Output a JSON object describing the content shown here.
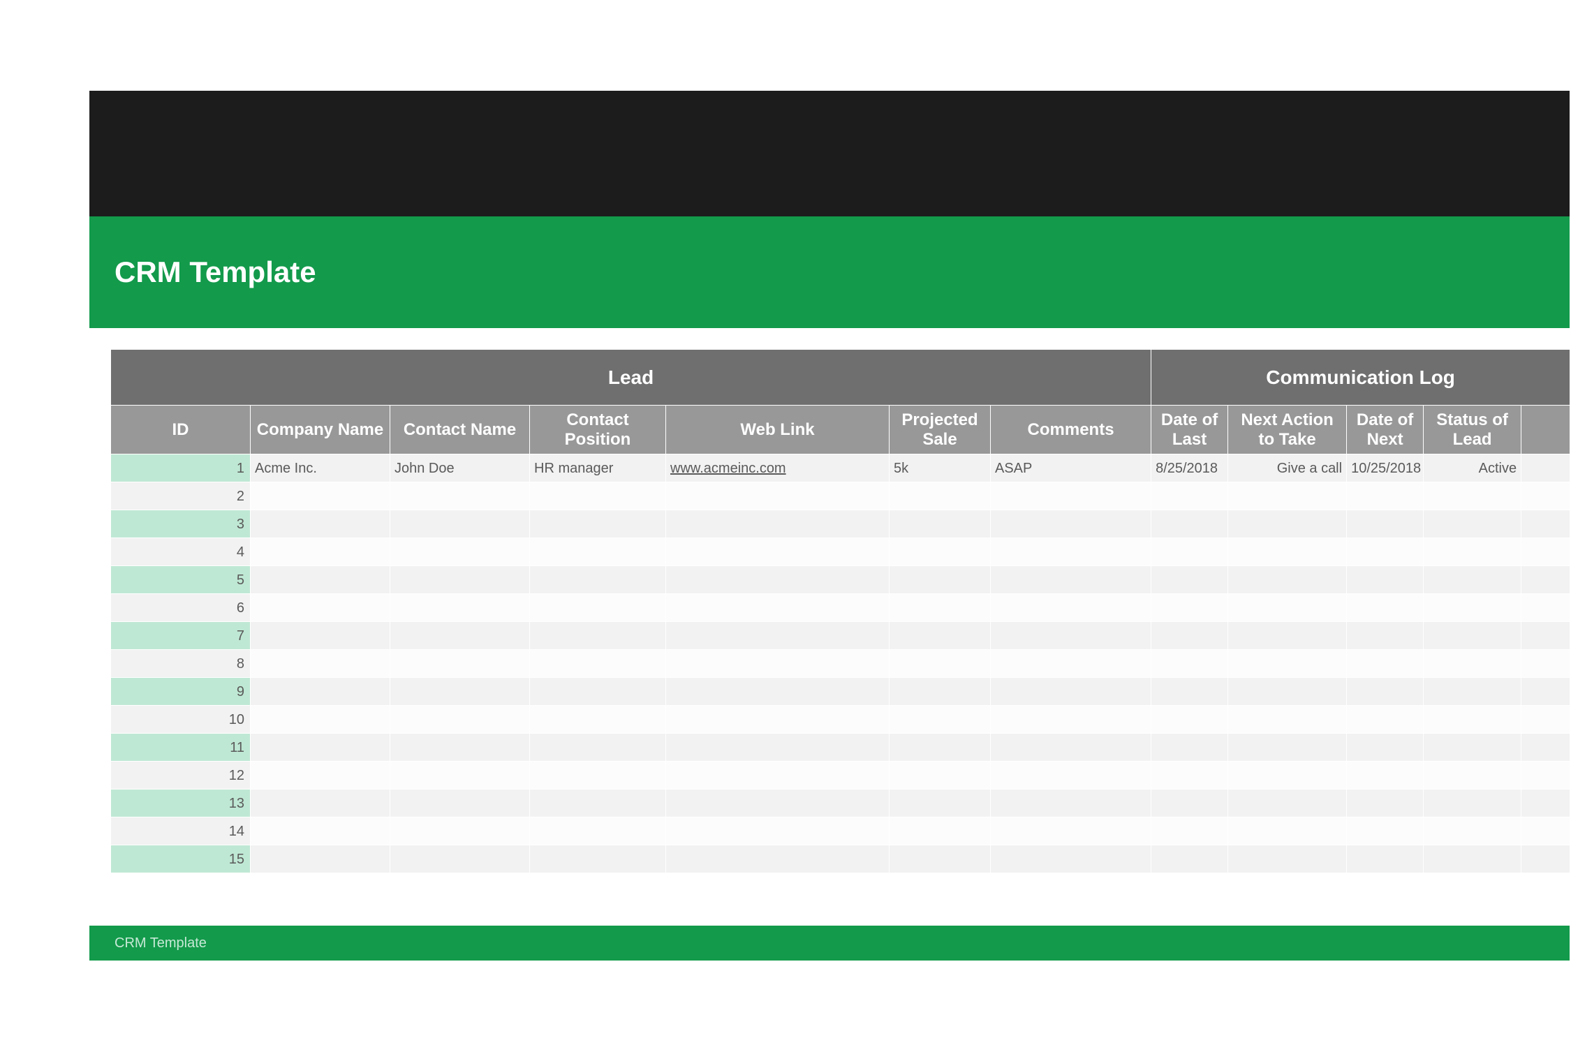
{
  "header": {
    "title": "CRM Template"
  },
  "groups": {
    "lead": "Lead",
    "comm_log": "Communication Log"
  },
  "columns": {
    "id": "ID",
    "company": "Company Name",
    "contact": "Contact Name",
    "position": "Contact Position",
    "web": "Web Link",
    "projected": "Projected Sale",
    "comments": "Comments",
    "date_last": "Date of Last",
    "next_action": "Next Action to Take",
    "date_next": "Date of Next",
    "status": "Status of Lead"
  },
  "rows": [
    {
      "id": "1",
      "company": "Acme Inc.",
      "contact": "John Doe",
      "position": "HR manager",
      "web": "www.acmeinc.com",
      "projected": "5k",
      "comments": "ASAP",
      "date_last": "8/25/2018",
      "next_action": "Give a call",
      "date_next": "10/25/2018",
      "status": "Active"
    },
    {
      "id": "2",
      "company": "",
      "contact": "",
      "position": "",
      "web": "",
      "projected": "",
      "comments": "",
      "date_last": "",
      "next_action": "",
      "date_next": "",
      "status": ""
    },
    {
      "id": "3",
      "company": "",
      "contact": "",
      "position": "",
      "web": "",
      "projected": "",
      "comments": "",
      "date_last": "",
      "next_action": "",
      "date_next": "",
      "status": ""
    },
    {
      "id": "4",
      "company": "",
      "contact": "",
      "position": "",
      "web": "",
      "projected": "",
      "comments": "",
      "date_last": "",
      "next_action": "",
      "date_next": "",
      "status": ""
    },
    {
      "id": "5",
      "company": "",
      "contact": "",
      "position": "",
      "web": "",
      "projected": "",
      "comments": "",
      "date_last": "",
      "next_action": "",
      "date_next": "",
      "status": ""
    },
    {
      "id": "6",
      "company": "",
      "contact": "",
      "position": "",
      "web": "",
      "projected": "",
      "comments": "",
      "date_last": "",
      "next_action": "",
      "date_next": "",
      "status": ""
    },
    {
      "id": "7",
      "company": "",
      "contact": "",
      "position": "",
      "web": "",
      "projected": "",
      "comments": "",
      "date_last": "",
      "next_action": "",
      "date_next": "",
      "status": ""
    },
    {
      "id": "8",
      "company": "",
      "contact": "",
      "position": "",
      "web": "",
      "projected": "",
      "comments": "",
      "date_last": "",
      "next_action": "",
      "date_next": "",
      "status": ""
    },
    {
      "id": "9",
      "company": "",
      "contact": "",
      "position": "",
      "web": "",
      "projected": "",
      "comments": "",
      "date_last": "",
      "next_action": "",
      "date_next": "",
      "status": ""
    },
    {
      "id": "10",
      "company": "",
      "contact": "",
      "position": "",
      "web": "",
      "projected": "",
      "comments": "",
      "date_last": "",
      "next_action": "",
      "date_next": "",
      "status": ""
    },
    {
      "id": "11",
      "company": "",
      "contact": "",
      "position": "",
      "web": "",
      "projected": "",
      "comments": "",
      "date_last": "",
      "next_action": "",
      "date_next": "",
      "status": ""
    },
    {
      "id": "12",
      "company": "",
      "contact": "",
      "position": "",
      "web": "",
      "projected": "",
      "comments": "",
      "date_last": "",
      "next_action": "",
      "date_next": "",
      "status": ""
    },
    {
      "id": "13",
      "company": "",
      "contact": "",
      "position": "",
      "web": "",
      "projected": "",
      "comments": "",
      "date_last": "",
      "next_action": "",
      "date_next": "",
      "status": ""
    },
    {
      "id": "14",
      "company": "",
      "contact": "",
      "position": "",
      "web": "",
      "projected": "",
      "comments": "",
      "date_last": "",
      "next_action": "",
      "date_next": "",
      "status": ""
    },
    {
      "id": "15",
      "company": "",
      "contact": "",
      "position": "",
      "web": "",
      "projected": "",
      "comments": "",
      "date_last": "",
      "next_action": "",
      "date_next": "",
      "status": ""
    }
  ],
  "footer": {
    "text": "CRM Template"
  }
}
